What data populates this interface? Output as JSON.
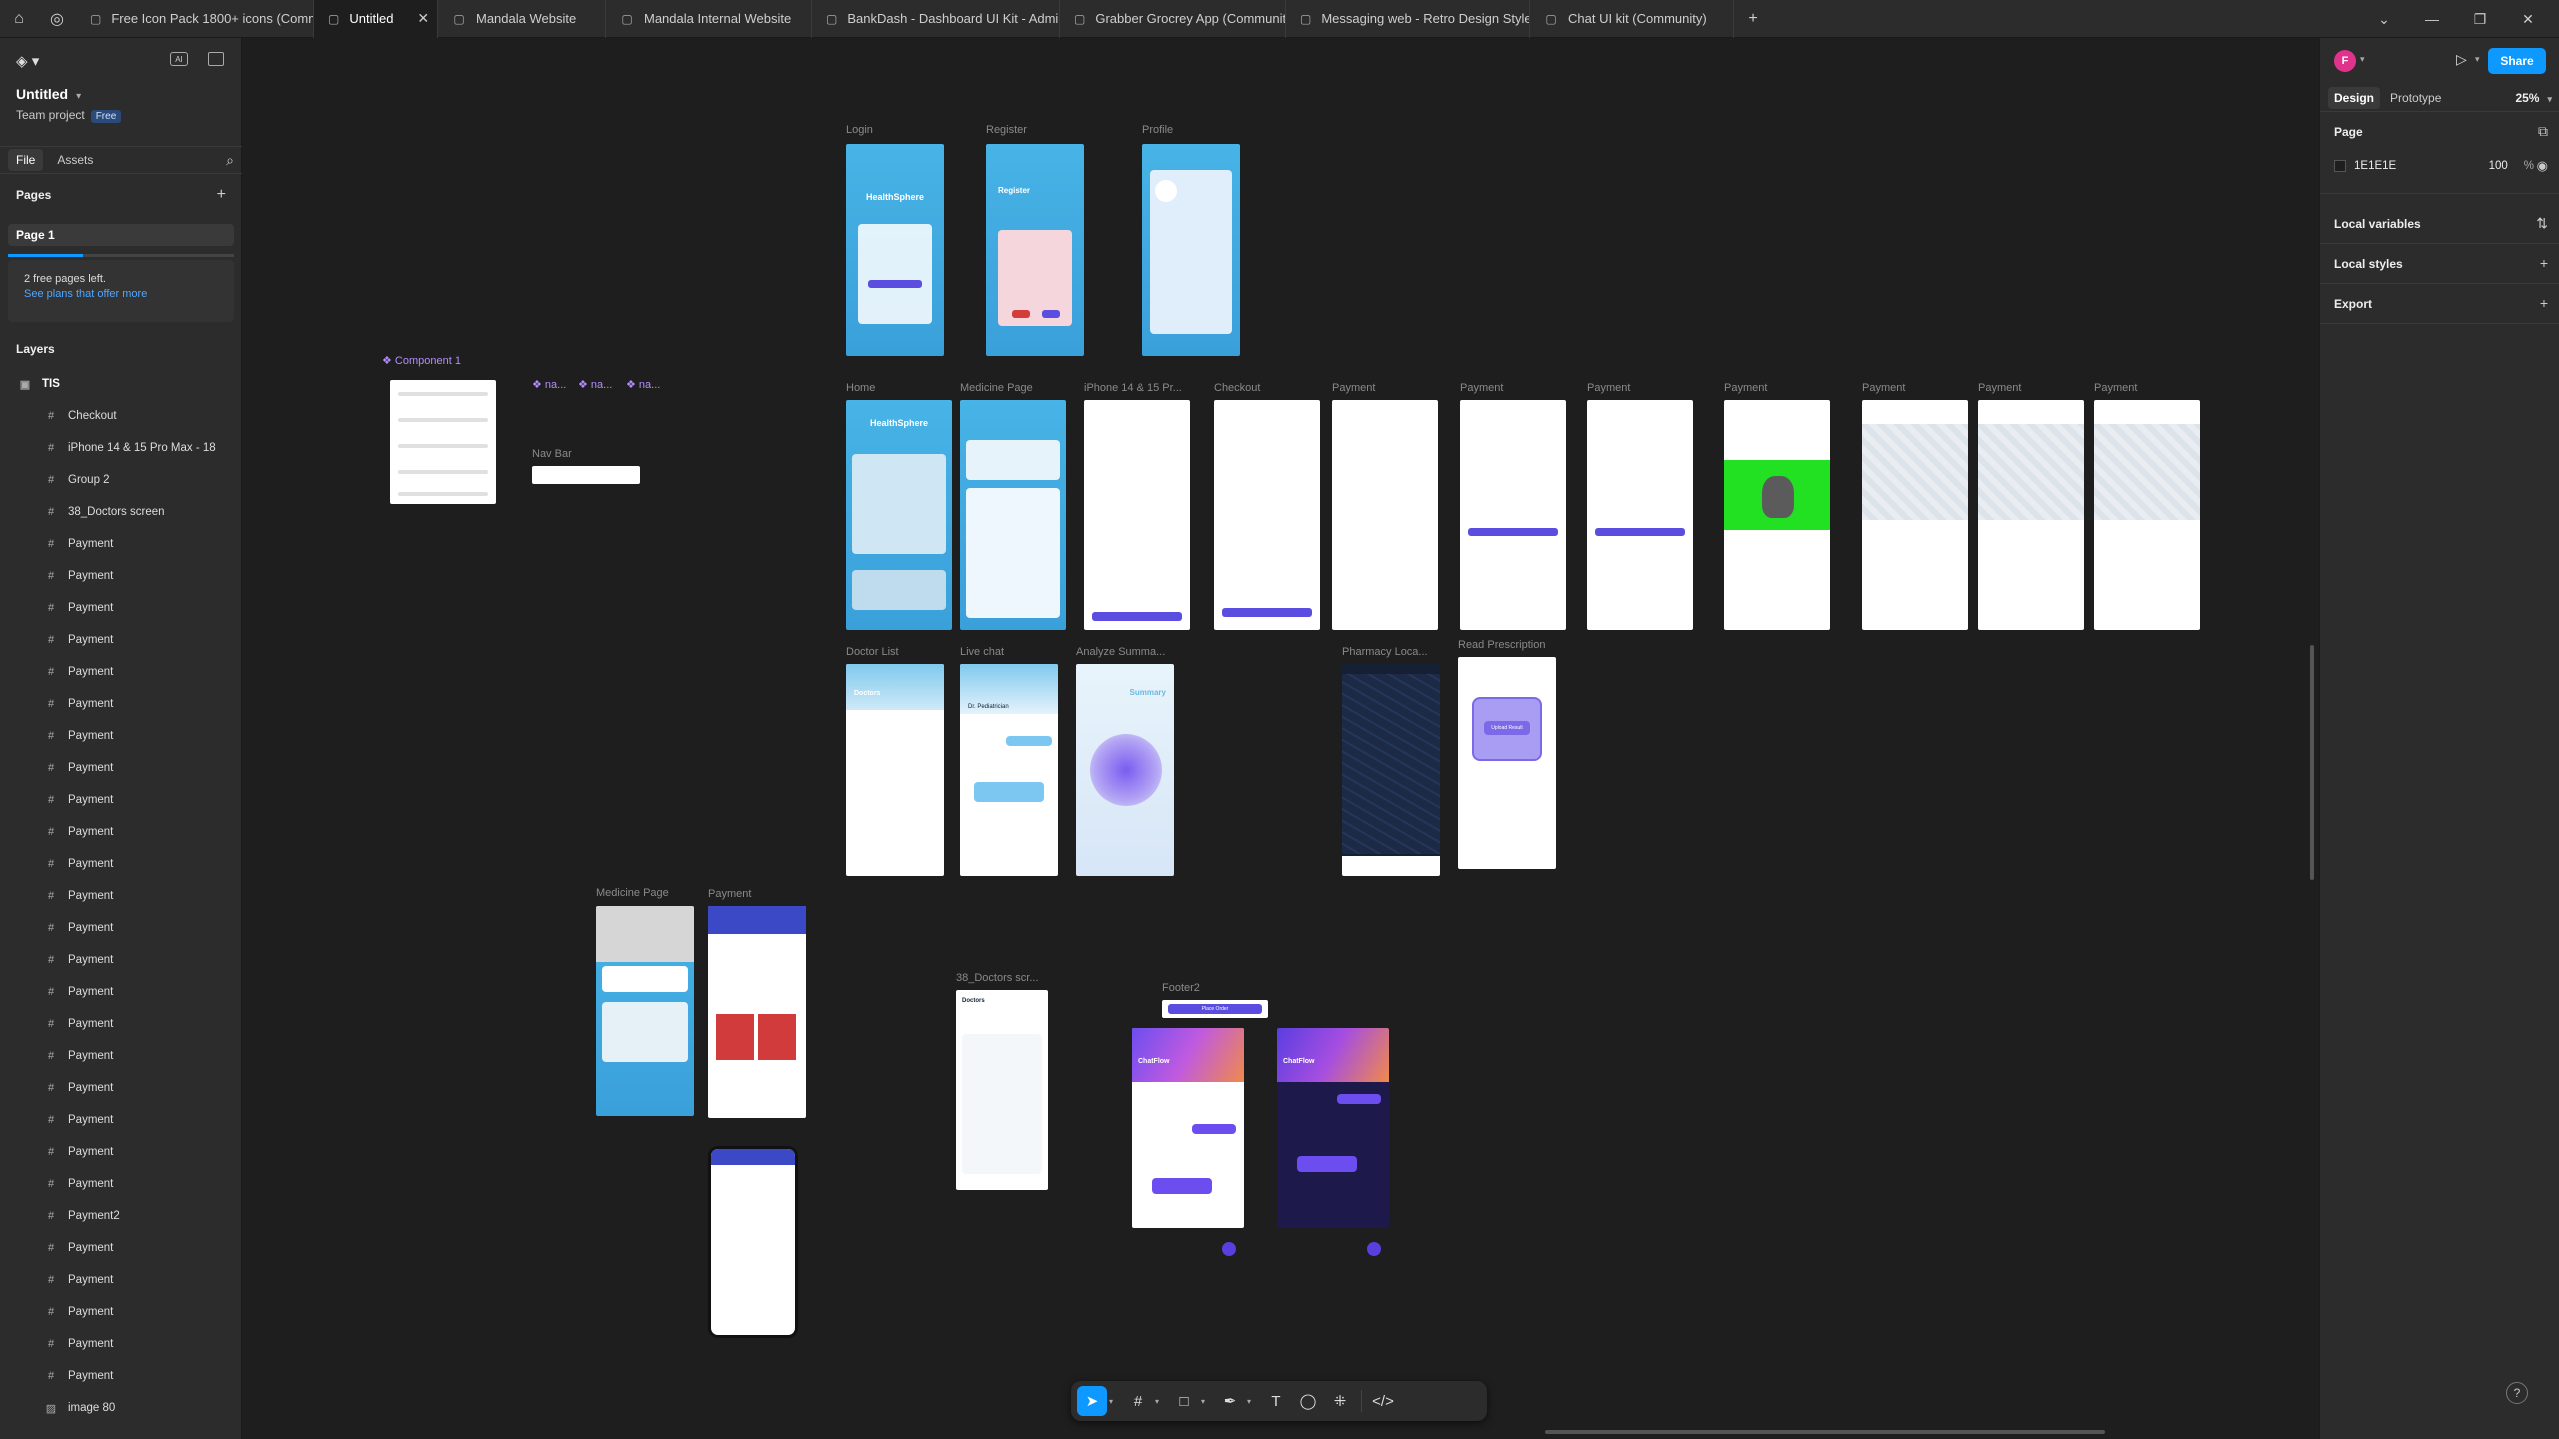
{
  "tabs": [
    {
      "label": "Free Icon Pack 1800+ icons (Commu",
      "active": false
    },
    {
      "label": "Untitled",
      "active": true
    },
    {
      "label": "Mandala Website",
      "active": false
    },
    {
      "label": "Mandala Internal Website",
      "active": false
    },
    {
      "label": "BankDash - Dashboard UI Kit - Admin",
      "active": false
    },
    {
      "label": "Grabber Grocrey App (Community)",
      "active": false
    },
    {
      "label": "Messaging web - Retro Design Style",
      "active": false
    },
    {
      "label": "Chat UI kit (Community)",
      "active": false
    }
  ],
  "file": {
    "title": "Untitled",
    "team": "Team project",
    "plan_badge": "Free"
  },
  "left_tabs": {
    "file": "File",
    "assets": "Assets"
  },
  "pages": {
    "header": "Pages",
    "items": [
      "Page 1"
    ],
    "note_line1": "2 free pages left.",
    "note_link": "See plans that offer more",
    "usage_fraction": 0.33
  },
  "layers": {
    "header": "Layers",
    "root": "TIS",
    "items": [
      "Checkout",
      "iPhone 14 & 15 Pro Max - 18",
      "Group 2",
      "38_Doctors screen",
      "Payment",
      "Payment",
      "Payment",
      "Payment",
      "Payment",
      "Payment",
      "Payment",
      "Payment",
      "Payment",
      "Payment",
      "Payment",
      "Payment",
      "Payment",
      "Payment",
      "Payment",
      "Payment",
      "Payment",
      "Payment",
      "Payment",
      "Payment",
      "Payment",
      "Payment2",
      "Payment",
      "Payment",
      "Payment",
      "Payment",
      "Payment",
      "image 80"
    ]
  },
  "canvas": {
    "labels": {
      "login": "Login",
      "register": "Register",
      "profile": "Profile",
      "component1": "Component 1",
      "navbar": "Nav Bar",
      "na1": "na...",
      "na2": "na...",
      "na3": "na...",
      "home": "Home",
      "medicine_page": "Medicine Page",
      "iphone": "iPhone 14 & 15 Pr...",
      "checkout": "Checkout",
      "payment": "Payment",
      "doctor_list": "Doctor List",
      "live_chat": "Live chat",
      "analyze": "Analyze Summa...",
      "pharmacy": "Pharmacy Loca...",
      "read_prescription": "Read Prescription",
      "medicine_page2": "Medicine Page",
      "payment2": "Payment",
      "doctors_screen": "38_Doctors scr...",
      "footer2": "Footer2"
    },
    "screen_text": {
      "healthsphere": "HealthSphere",
      "register": "Register",
      "doctors": "Doctors",
      "summary": "Summary",
      "chatflow": "ChatFlow",
      "upload_result": "Upload Result",
      "dr_name": "Dr. Pediatrician",
      "checkout_btn": "Place Order"
    }
  },
  "right": {
    "avatar_letter": "F",
    "share": "Share",
    "tabs": {
      "design": "Design",
      "prototype": "Prototype"
    },
    "zoom": "25%",
    "page_section": "Page",
    "page_color": "1E1E1E",
    "page_opacity": "100",
    "pct": "%",
    "local_variables": "Local variables",
    "local_styles": "Local styles",
    "export": "Export"
  },
  "colors": {
    "accent": "#0d99ff",
    "canvas_bg": "#1e1e1e",
    "panel_bg": "#2c2c2c",
    "component": "#b38cff"
  }
}
